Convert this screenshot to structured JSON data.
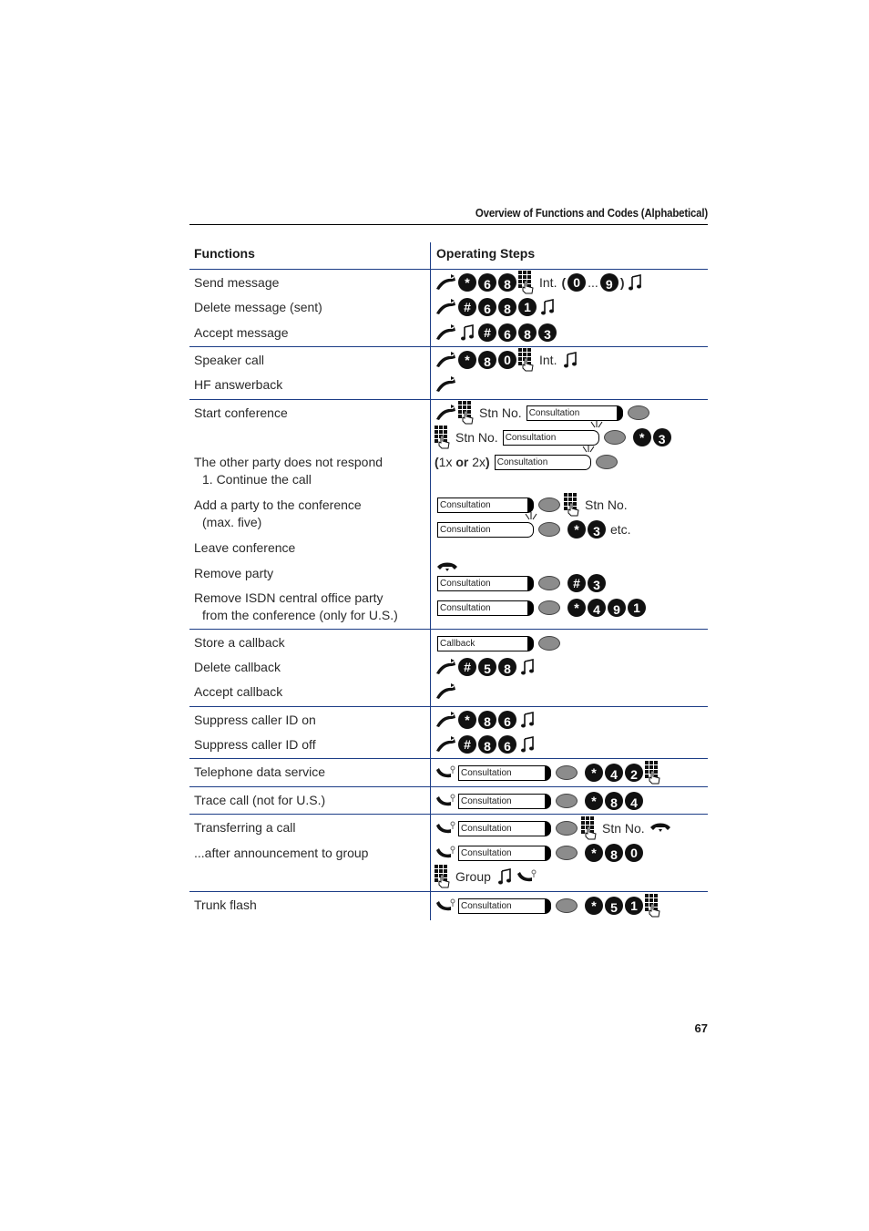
{
  "page": {
    "header_title": "Overview of Functions and Codes (Alphabetical)",
    "page_number": "67"
  },
  "table": {
    "headers": {
      "functions": "Functions",
      "operating_steps": "Operating Steps"
    },
    "labels": {
      "int": "Int.",
      "stn_no": "Stn No.",
      "group": "Group",
      "etc": "etc.",
      "ellipsis": "...",
      "one_or_two_x": "1x",
      "or": "or",
      "two_x": "2x",
      "consultation": "Consultation",
      "callback": "Callback"
    },
    "rows": [
      {
        "function": "Send message",
        "keys": [
          "*",
          "6",
          "8"
        ],
        "range": [
          "0",
          "9"
        ]
      },
      {
        "function": "Delete message (sent)",
        "keys": [
          "#",
          "6",
          "8",
          "1"
        ]
      },
      {
        "function": "Accept message",
        "keys": [
          "#",
          "6",
          "8",
          "3"
        ]
      },
      {
        "function": "Speaker call",
        "keys": [
          "*",
          "8",
          "0"
        ]
      },
      {
        "function": "HF answerback"
      },
      {
        "function": "Start conference"
      },
      {
        "function": "The other party does not respond",
        "sub": "1. Continue the call"
      },
      {
        "function": "Add a party to the conference",
        "sub": "(max. five)"
      },
      {
        "function": "Leave conference"
      },
      {
        "function": "Remove party",
        "keys": [
          "#",
          "3"
        ]
      },
      {
        "function": "Remove ISDN central office party",
        "sub": "from the conference (only for U.S.)",
        "keys": [
          "*",
          "4",
          "9",
          "1"
        ]
      },
      {
        "function": "Store a callback"
      },
      {
        "function": "Delete callback",
        "keys": [
          "#",
          "5",
          "8"
        ]
      },
      {
        "function": "Accept callback"
      },
      {
        "function": "Suppress caller ID on",
        "keys": [
          "*",
          "8",
          "6"
        ]
      },
      {
        "function": "Suppress caller ID off",
        "keys": [
          "#",
          "8",
          "6"
        ]
      },
      {
        "function": "Telephone data service",
        "keys": [
          "*",
          "4",
          "2"
        ]
      },
      {
        "function": "Trace call (not for U.S.)",
        "keys": [
          "*",
          "8",
          "4"
        ]
      },
      {
        "function": "Transferring a call"
      },
      {
        "function": "...after announcement to group",
        "keys": [
          "*",
          "8",
          "0"
        ]
      },
      {
        "function": "Trunk flash",
        "keys": [
          "*",
          "5",
          "1"
        ]
      }
    ],
    "conference_keys": {
      "star3": [
        "*",
        "3"
      ]
    }
  }
}
